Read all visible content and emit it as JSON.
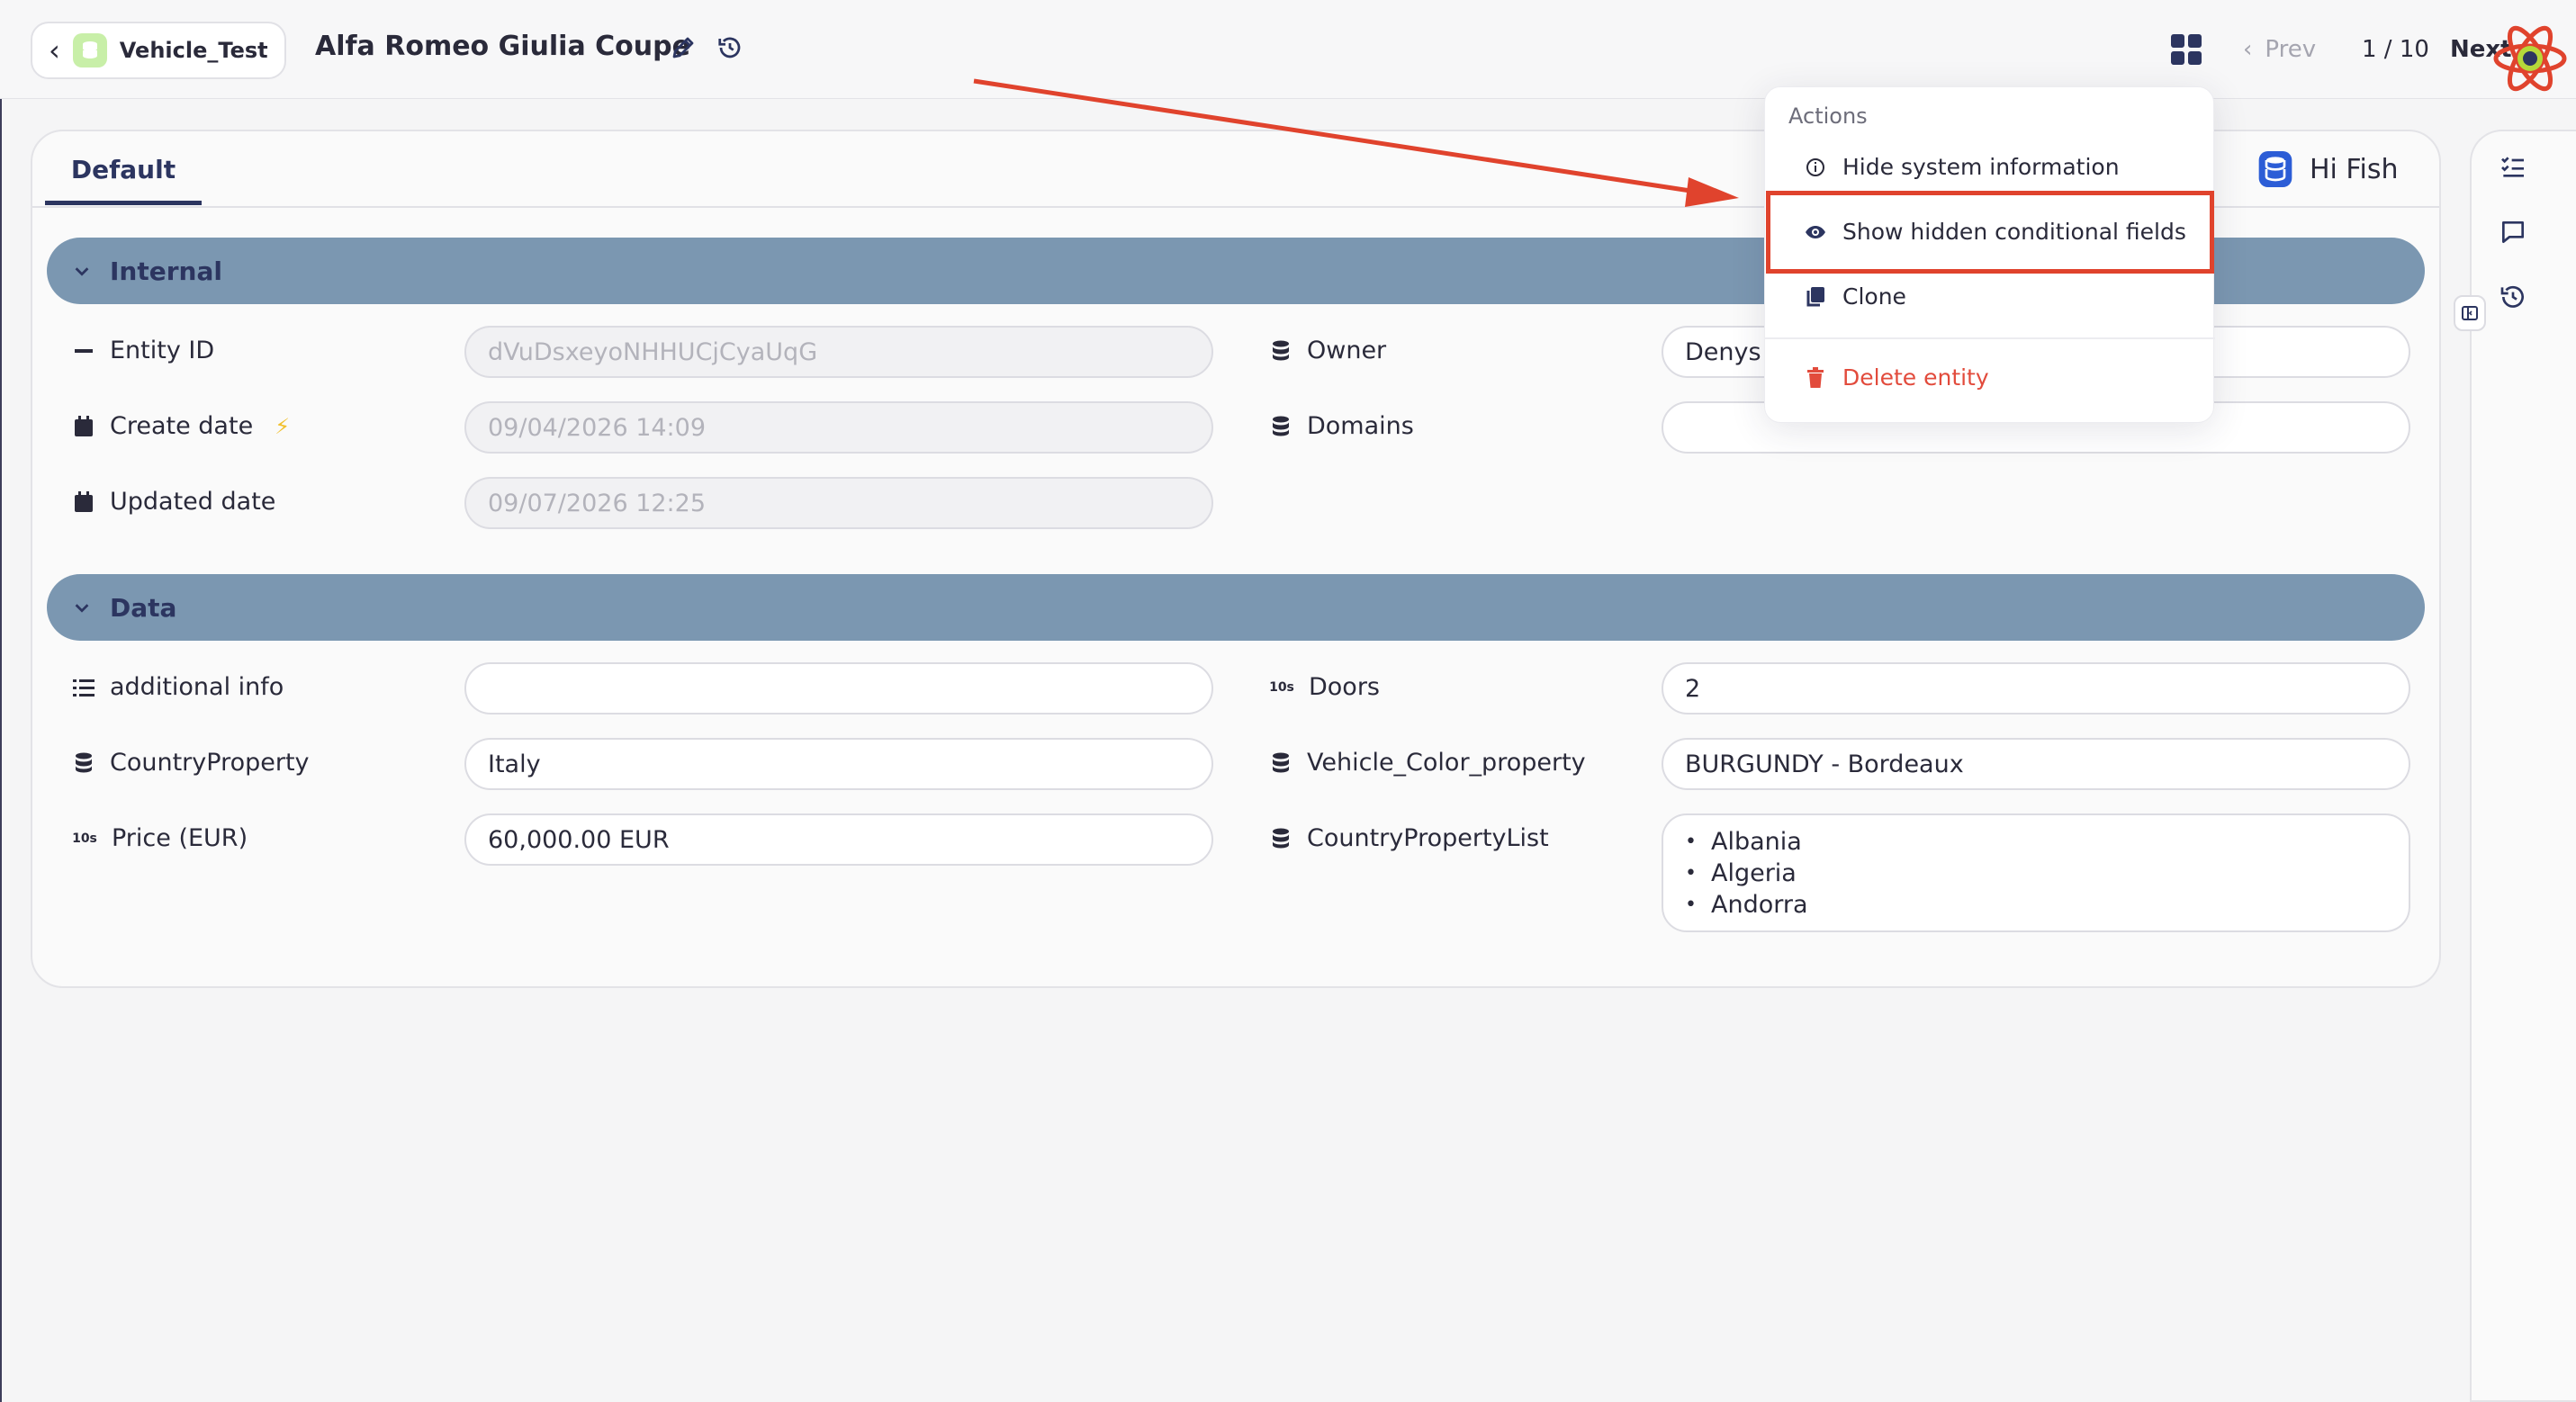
{
  "topbar": {
    "back_label": "Vehicle_Test",
    "title": "Alfa Romeo Giulia Coupe",
    "prev_label": "Prev",
    "pager": "1 / 10",
    "next_label": "Next"
  },
  "tabs": [
    {
      "label": "Default"
    }
  ],
  "user": {
    "name": "Hi Fish"
  },
  "sections": {
    "internal": {
      "label": "Internal",
      "fields": {
        "entity_id": {
          "label": "Entity ID",
          "value": "dVuDsxeyoNHHUCjCyaUqG"
        },
        "create_date": {
          "label": "Create date",
          "value": "09/04/2026 14:09"
        },
        "updated_date": {
          "label": "Updated date",
          "value": "09/07/2026 12:25"
        },
        "owner": {
          "label": "Owner",
          "value": "Denys"
        },
        "domains": {
          "label": "Domains",
          "value": ""
        }
      }
    },
    "data": {
      "label": "Data",
      "fields": {
        "additional_info": {
          "label": "additional info",
          "value": ""
        },
        "country_property": {
          "label": "CountryProperty",
          "value": "Italy"
        },
        "price": {
          "label": "Price (EUR)",
          "value": "60,000.00 EUR"
        },
        "doors": {
          "label": "Doors",
          "value": "2"
        },
        "vehicle_color": {
          "label": "Vehicle_Color_property",
          "value": "BURGUNDY - Bordeaux"
        },
        "country_list": {
          "label": "CountryPropertyList",
          "values": [
            "Albania",
            "Algeria",
            "Andorra"
          ]
        }
      }
    }
  },
  "number_icon_text": "10s",
  "actions_menu": {
    "heading": "Actions",
    "items": [
      {
        "label": "Hide system information",
        "icon": "info-icon"
      },
      {
        "label": "Show hidden conditional fields",
        "icon": "eye-icon"
      },
      {
        "label": "Clone",
        "icon": "copy-icon"
      },
      {
        "label": "Delete entity",
        "icon": "trash-icon"
      }
    ]
  },
  "colors": {
    "section_bar": "#7b97b1",
    "primary": "#2c3560",
    "danger": "#e24b3c",
    "annotation": "#e0432d",
    "back_db_icon": "#c8efa8"
  }
}
